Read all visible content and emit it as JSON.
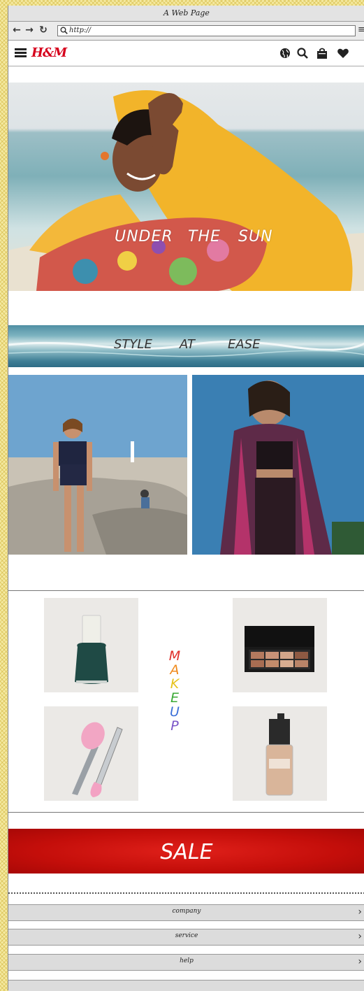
{
  "window": {
    "title": "A Web Page"
  },
  "address_bar": {
    "url": "http://"
  },
  "site": {
    "logo": "H&M"
  },
  "hero": {
    "words": [
      "UNDER",
      "THE",
      "SUN"
    ]
  },
  "banner": {
    "words": [
      "STYLE",
      "AT",
      "EASE"
    ]
  },
  "makeup": {
    "letters": [
      {
        "char": "M",
        "color": "#e0302a"
      },
      {
        "char": "A",
        "color": "#f08a1c"
      },
      {
        "char": "K",
        "color": "#e6c21a"
      },
      {
        "char": "E",
        "color": "#3aaa35"
      },
      {
        "char": "U",
        "color": "#3a6fd8"
      },
      {
        "char": "P",
        "color": "#7a55c8"
      }
    ]
  },
  "sale": {
    "label": "SALE"
  },
  "footer": {
    "items": [
      {
        "label": "company"
      },
      {
        "label": "service"
      },
      {
        "label": "help"
      }
    ]
  },
  "icons": {
    "back": "arrow-left-icon",
    "forward": "arrow-right-icon",
    "reload": "reload-icon",
    "search": "search-icon",
    "menu": "hamburger-icon",
    "globe": "globe-icon",
    "bag": "shopping-bag-icon",
    "heart": "heart-icon",
    "chevron": "chevron-right-icon"
  }
}
